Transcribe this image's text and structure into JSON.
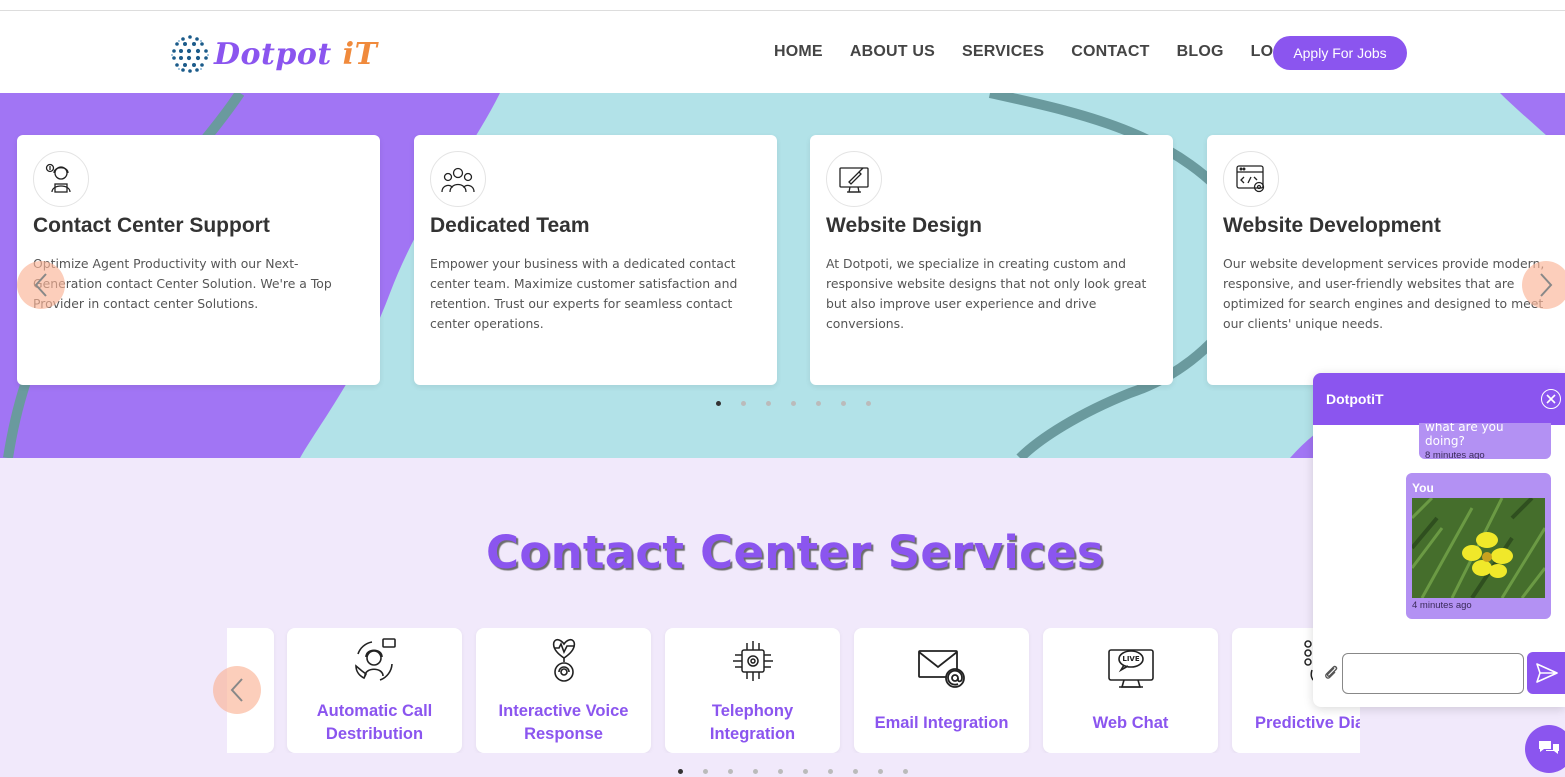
{
  "brand": {
    "logo_main": "Dotpot ",
    "logo_accent": "iT",
    "primary_color": "#8b55ef",
    "accent_color": "#f08a3c"
  },
  "nav": {
    "items": [
      "HOME",
      "ABOUT US",
      "SERVICES",
      "CONTACT",
      "BLOG",
      "LOGIN"
    ],
    "cta": "Apply For Jobs"
  },
  "hero": {
    "cards": [
      {
        "icon": "support-agent-icon",
        "title": "Contact Center Support",
        "text": "Optimize Agent Productivity with our Next-Generation contact Center Solution. We're a Top Provider in contact center Solutions."
      },
      {
        "icon": "team-icon",
        "title": "Dedicated Team",
        "text": "Empower your business with a dedicated contact center team. Maximize customer satisfaction and retention. Trust our experts for seamless contact center operations."
      },
      {
        "icon": "design-monitor-icon",
        "title": "Website Design",
        "text": "At Dotpoti, we specialize in creating custom and responsive website designs that not only look great but also improve user experience and drive conversions."
      },
      {
        "icon": "code-settings-icon",
        "title": "Website Development",
        "text": "Our website development services provide modern, responsive, and user-friendly websites that are optimized for search engines and designed to meet our clients' unique needs."
      }
    ],
    "dots_count": 7,
    "active_dot": 0
  },
  "services": {
    "title": "Contact Center Services",
    "cards": [
      {
        "label": "Automatic Call Destribution",
        "icon": "call-distribution-icon"
      },
      {
        "label": "Interactive Voice Response",
        "icon": "voice-response-icon"
      },
      {
        "label": "Telephony Integration",
        "icon": "chip-icon"
      },
      {
        "label": "Email Integration",
        "icon": "email-icon"
      },
      {
        "label": "Web Chat",
        "icon": "live-chat-icon"
      },
      {
        "label": "Predictive Dia",
        "icon": "dialpad-icon"
      }
    ],
    "dots_count": 10,
    "active_dot": 0
  },
  "chat": {
    "title": "DotpotiT",
    "prev_message": "what are you doing?",
    "prev_time": "8 minutes ago",
    "image_sender": "You",
    "image_time": "4 minutes ago"
  }
}
